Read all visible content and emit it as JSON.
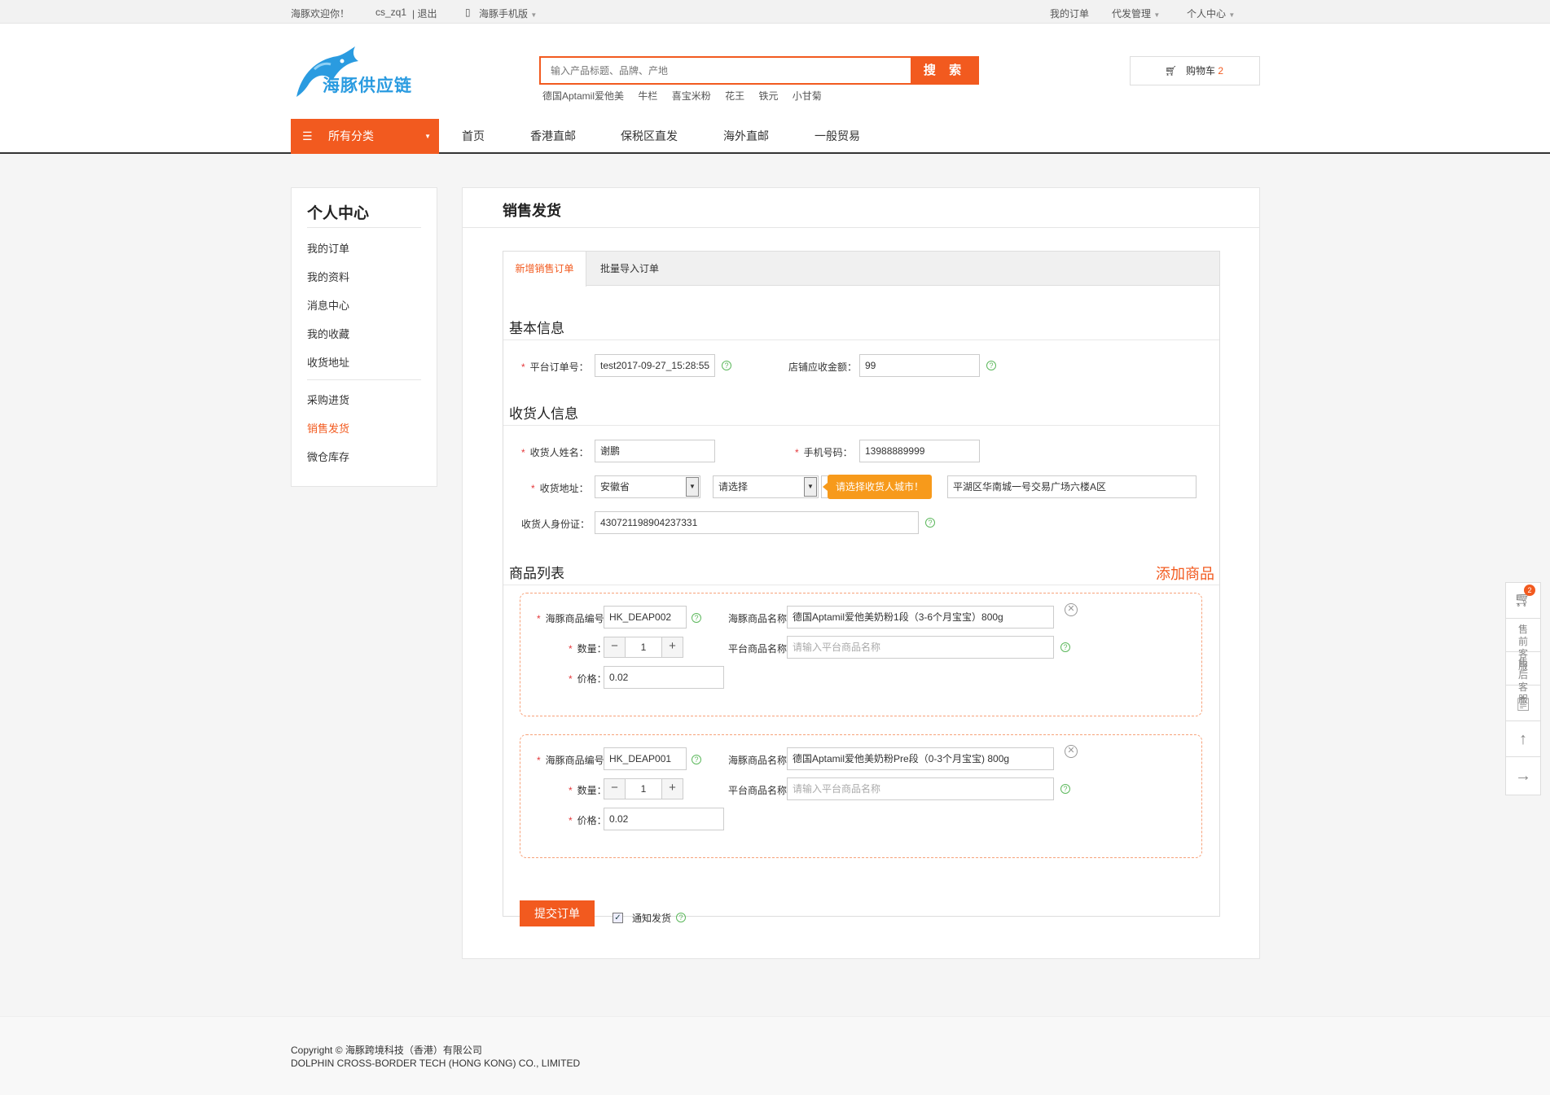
{
  "topbar": {
    "welcome": "海豚欢迎你！",
    "username": "cs_zq1",
    "logout": "| 退出",
    "mobile": "海豚手机版",
    "my_orders": "我的订单",
    "agent": "代发管理",
    "user_center": "个人中心"
  },
  "header": {
    "logo_text": "海豚供应链",
    "search_placeholder": "输入产品标题、品牌、产地",
    "search_button": "搜 索",
    "hot_words": [
      "德国Aptamil爱他美",
      "牛栏",
      "喜宝米粉",
      "花王",
      "铁元",
      "小甘菊"
    ],
    "cart_label": "购物车",
    "cart_count": "2"
  },
  "nav": {
    "all_categories": "所有分类",
    "items": [
      "首页",
      "香港直邮",
      "保税区直发",
      "海外直邮",
      "一般贸易"
    ]
  },
  "sidebar": {
    "title": "个人中心",
    "group1": [
      "我的订单",
      "我的资料",
      "消息中心",
      "我的收藏",
      "收货地址"
    ],
    "group2": [
      "采购进货",
      "销售发货",
      "微仓库存"
    ],
    "active": "销售发货"
  },
  "page": {
    "title": "销售发货",
    "tabs": [
      "新增销售订单",
      "批量导入订单"
    ],
    "basic_title": "基本信息",
    "order_no_label": "平台订单号：",
    "order_no": "test2017-09-27_15:28:55",
    "amount_label": "店铺应收金额：",
    "amount": "99",
    "consignee_title": "收货人信息",
    "name_label": "收货人姓名：",
    "name": "谢鹏",
    "phone_label": "手机号码：",
    "phone": "13988889999",
    "address_label": "收货地址：",
    "province": "安徽省",
    "city_placeholder": "请选择",
    "tooltip": "请选择收货人城市！",
    "street": "平湖区华南城一号交易广场六楼A区",
    "id_label": "收货人身份证：",
    "id_no": "430721198904237331",
    "goods_title": "商品列表",
    "add_goods": "添加商品",
    "goods": [
      {
        "code_label": "海豚商品编号：",
        "code": "HK_DEAP002",
        "name_label": "海豚商品名称：",
        "name": "德国Aptamil爱他美奶粉1段（3-6个月宝宝）800g",
        "qty_label": "数量：",
        "qty": "1",
        "platform_label": "平台商品名称：",
        "platform_placeholder": "请输入平台商品名称",
        "price_label": "价格：",
        "price": "0.02"
      },
      {
        "code_label": "海豚商品编号：",
        "code": "HK_DEAP001",
        "name_label": "海豚商品名称：",
        "name": "德国Aptamil爱他美奶粉Pre段（0-3个月宝宝) 800g",
        "qty_label": "数量：",
        "qty": "1",
        "platform_label": "平台商品名称：",
        "platform_placeholder": "请输入平台商品名称",
        "price_label": "价格：",
        "price": "0.02"
      }
    ],
    "submit": "提交订单",
    "notify": "通知发货"
  },
  "footer": {
    "line1": "Copyright ©  海豚跨境科技（香港）有限公司",
    "line2": "DOLPHIN CROSS-BORDER TECH (HONG KONG) CO., LIMITED"
  },
  "float_bar": {
    "cart_badge": "2",
    "presale": "售前客服",
    "aftersale": "售后客服"
  },
  "colors": {
    "accent": "#f25a1f",
    "tooltip": "#f79a1b",
    "help": "#5cb85c",
    "brand_blue": "#2a9be0"
  }
}
